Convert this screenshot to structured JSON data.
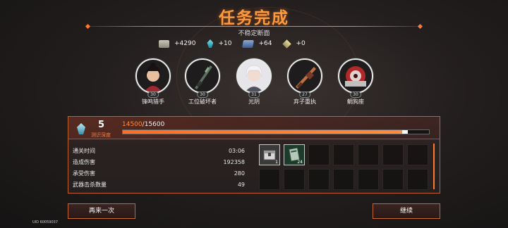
{
  "title": "任务完成",
  "subtitle": "不稳定断面",
  "rewards": [
    {
      "icon": "money-icon",
      "value": "+4290"
    },
    {
      "icon": "crystal-icon",
      "value": "+10"
    },
    {
      "icon": "chip-icon",
      "value": "+64"
    },
    {
      "icon": "cube-icon",
      "value": "+0"
    }
  ],
  "characters": [
    {
      "name": "锋鸣猎手",
      "level": "30",
      "skin": "#e8c0a0",
      "hair": "#1a1212",
      "clothes": "#a02830"
    },
    {
      "name": "工位破坏者",
      "level": "30",
      "skin": "#d0d0d0",
      "hair": "#2a3a30",
      "clothes": "#3a4a40"
    },
    {
      "name": "光阴",
      "level": "31",
      "skin": "#f0dcd0",
      "hair": "#e8e8ee",
      "clothes": "#505060"
    },
    {
      "name": "弃子重执",
      "level": "27",
      "skin": "#d0a070",
      "hair": "#7a3a28",
      "clothes": "#5a3020"
    },
    {
      "name": "鲷狗座",
      "level": "30",
      "skin": "#e0d0d0",
      "hair": "#b02828",
      "clothes": "#c0c0c0"
    }
  ],
  "depth": {
    "value": "5",
    "label": "测识深度"
  },
  "exp": {
    "current": "14500",
    "separator": "/",
    "max": "15600",
    "progress": 0.93
  },
  "stats": [
    {
      "label": "通关时间",
      "value": "03:06"
    },
    {
      "label": "造成伤害",
      "value": "192358"
    },
    {
      "label": "承受伤害",
      "value": "280"
    },
    {
      "label": "武器击杀数量",
      "value": "49"
    }
  ],
  "items": [
    {
      "icon": "chest-icon",
      "count": "1"
    },
    {
      "icon": "card-icon",
      "count": "24"
    }
  ],
  "buttons": {
    "retry": "再来一次",
    "continue": "继续"
  },
  "uid": "UID 60059037",
  "colors": {
    "accent": "#ff7a2e",
    "panel_border": "#c2602a"
  }
}
